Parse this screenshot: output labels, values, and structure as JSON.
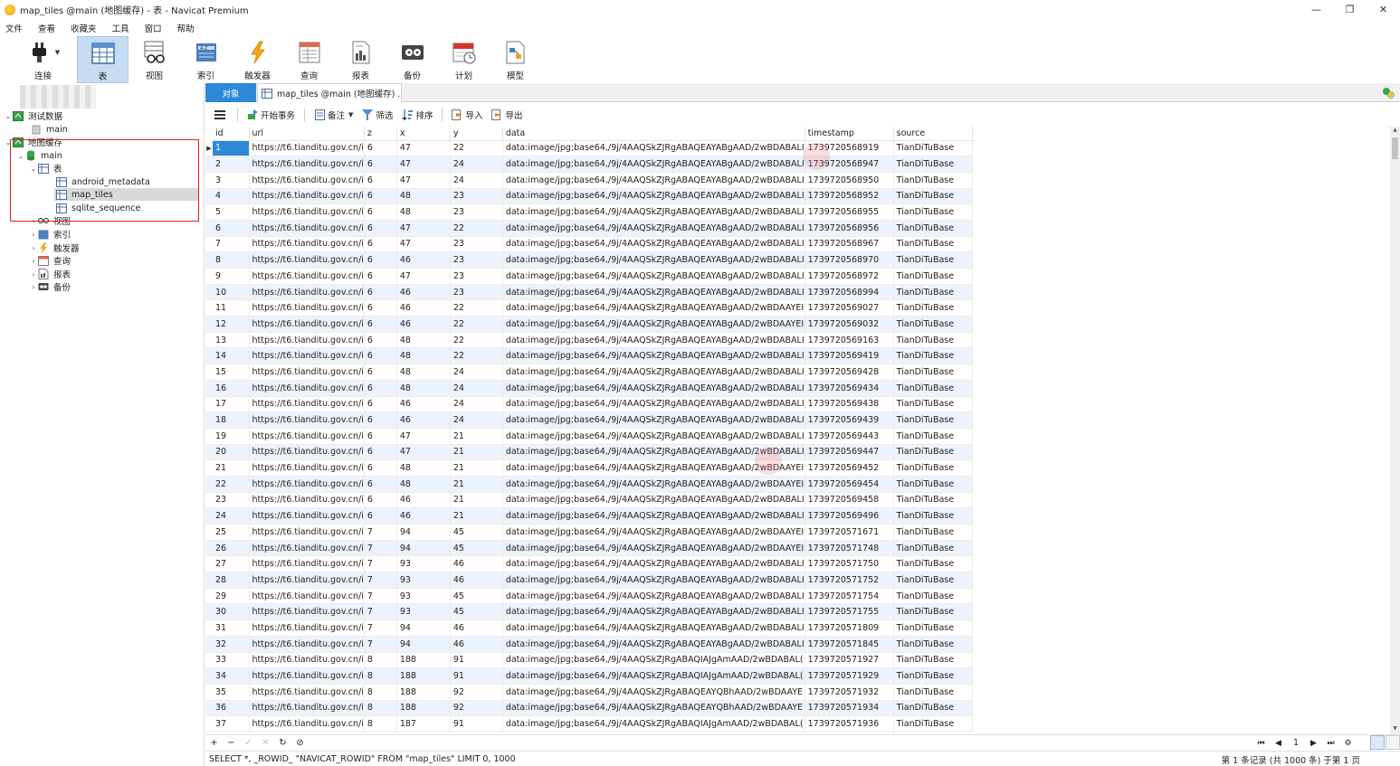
{
  "window": {
    "title": "map_tiles @main (地图缓存) - 表 - Navicat Premium",
    "minimize": "—",
    "restore": "❐",
    "close": "✕"
  },
  "menu": [
    "文件",
    "查看",
    "收藏夹",
    "工具",
    "窗口",
    "帮助"
  ],
  "toolbar": {
    "connect": "连接",
    "table": "表",
    "view": "视图",
    "index": "索引",
    "trigger": "触发器",
    "query": "查询",
    "report": "报表",
    "backup": "备份",
    "schedule": "计划",
    "model": "模型"
  },
  "tree": {
    "conn1": "测试数据",
    "conn1_db": "main",
    "conn2": "地图缓存",
    "conn2_db": "main",
    "tables_group": "表",
    "tables": [
      "android_metadata",
      "map_tiles",
      "sqlite_sequence"
    ],
    "groups": [
      "视图",
      "索引",
      "触发器",
      "查询",
      "报表",
      "备份"
    ]
  },
  "tabs": {
    "objects": "对象",
    "table_tab": "map_tiles @main (地图缓存) ..."
  },
  "grid_toolbar": {
    "begin_tx": "开始事务",
    "comment": "备注",
    "filter": "筛选",
    "sort": "排序",
    "import": "导入",
    "export": "导出"
  },
  "columns": [
    "id",
    "url",
    "z",
    "x",
    "y",
    "data",
    "timestamp",
    "source"
  ],
  "rows": [
    [
      "1",
      "https://t6.tianditu.gov.cn/i",
      "6",
      "47",
      "22",
      "data:image/jpg;base64,/9j/4AAQSkZJRgABAQEAYABgAAD/2wBDABALI",
      "1739720568919",
      "TianDiTuBase"
    ],
    [
      "2",
      "https://t6.tianditu.gov.cn/i",
      "6",
      "47",
      "24",
      "data:image/jpg;base64,/9j/4AAQSkZJRgABAQEAYABgAAD/2wBDABALI",
      "1739720568947",
      "TianDiTuBase"
    ],
    [
      "3",
      "https://t6.tianditu.gov.cn/i",
      "6",
      "47",
      "24",
      "data:image/jpg;base64,/9j/4AAQSkZJRgABAQEAYABgAAD/2wBDABALI",
      "1739720568950",
      "TianDiTuBase"
    ],
    [
      "4",
      "https://t6.tianditu.gov.cn/i",
      "6",
      "48",
      "23",
      "data:image/jpg;base64,/9j/4AAQSkZJRgABAQEAYABgAAD/2wBDABALI",
      "1739720568952",
      "TianDiTuBase"
    ],
    [
      "5",
      "https://t6.tianditu.gov.cn/i",
      "6",
      "48",
      "23",
      "data:image/jpg;base64,/9j/4AAQSkZJRgABAQEAYABgAAD/2wBDABALI",
      "1739720568955",
      "TianDiTuBase"
    ],
    [
      "6",
      "https://t6.tianditu.gov.cn/i",
      "6",
      "47",
      "22",
      "data:image/jpg;base64,/9j/4AAQSkZJRgABAQEAYABgAAD/2wBDABALI",
      "1739720568956",
      "TianDiTuBase"
    ],
    [
      "7",
      "https://t6.tianditu.gov.cn/i",
      "6",
      "47",
      "23",
      "data:image/jpg;base64,/9j/4AAQSkZJRgABAQEAYABgAAD/2wBDABALI",
      "1739720568967",
      "TianDiTuBase"
    ],
    [
      "8",
      "https://t6.tianditu.gov.cn/i",
      "6",
      "46",
      "23",
      "data:image/jpg;base64,/9j/4AAQSkZJRgABAQEAYABgAAD/2wBDABALI",
      "1739720568970",
      "TianDiTuBase"
    ],
    [
      "9",
      "https://t6.tianditu.gov.cn/i",
      "6",
      "47",
      "23",
      "data:image/jpg;base64,/9j/4AAQSkZJRgABAQEAYABgAAD/2wBDABALI",
      "1739720568972",
      "TianDiTuBase"
    ],
    [
      "10",
      "https://t6.tianditu.gov.cn/i",
      "6",
      "46",
      "23",
      "data:image/jpg;base64,/9j/4AAQSkZJRgABAQEAYABgAAD/2wBDABALI",
      "1739720568994",
      "TianDiTuBase"
    ],
    [
      "11",
      "https://t6.tianditu.gov.cn/i",
      "6",
      "46",
      "22",
      "data:image/jpg;base64,/9j/4AAQSkZJRgABAQEAYABgAAD/2wBDAAYEI",
      "1739720569027",
      "TianDiTuBase"
    ],
    [
      "12",
      "https://t6.tianditu.gov.cn/i",
      "6",
      "46",
      "22",
      "data:image/jpg;base64,/9j/4AAQSkZJRgABAQEAYABgAAD/2wBDAAYEI",
      "1739720569032",
      "TianDiTuBase"
    ],
    [
      "13",
      "https://t6.tianditu.gov.cn/i",
      "6",
      "48",
      "22",
      "data:image/jpg;base64,/9j/4AAQSkZJRgABAQEAYABgAAD/2wBDABALI",
      "1739720569163",
      "TianDiTuBase"
    ],
    [
      "14",
      "https://t6.tianditu.gov.cn/i",
      "6",
      "48",
      "22",
      "data:image/jpg;base64,/9j/4AAQSkZJRgABAQEAYABgAAD/2wBDABALI",
      "1739720569419",
      "TianDiTuBase"
    ],
    [
      "15",
      "https://t6.tianditu.gov.cn/i",
      "6",
      "48",
      "24",
      "data:image/jpg;base64,/9j/4AAQSkZJRgABAQEAYABgAAD/2wBDABALI",
      "1739720569428",
      "TianDiTuBase"
    ],
    [
      "16",
      "https://t6.tianditu.gov.cn/i",
      "6",
      "48",
      "24",
      "data:image/jpg;base64,/9j/4AAQSkZJRgABAQEAYABgAAD/2wBDABALI",
      "1739720569434",
      "TianDiTuBase"
    ],
    [
      "17",
      "https://t6.tianditu.gov.cn/i",
      "6",
      "46",
      "24",
      "data:image/jpg;base64,/9j/4AAQSkZJRgABAQEAYABgAAD/2wBDABALI",
      "1739720569438",
      "TianDiTuBase"
    ],
    [
      "18",
      "https://t6.tianditu.gov.cn/i",
      "6",
      "46",
      "24",
      "data:image/jpg;base64,/9j/4AAQSkZJRgABAQEAYABgAAD/2wBDABALI",
      "1739720569439",
      "TianDiTuBase"
    ],
    [
      "19",
      "https://t6.tianditu.gov.cn/i",
      "6",
      "47",
      "21",
      "data:image/jpg;base64,/9j/4AAQSkZJRgABAQEAYABgAAD/2wBDABALI",
      "1739720569443",
      "TianDiTuBase"
    ],
    [
      "20",
      "https://t6.tianditu.gov.cn/i",
      "6",
      "47",
      "21",
      "data:image/jpg;base64,/9j/4AAQSkZJRgABAQEAYABgAAD/2wBDABALI",
      "1739720569447",
      "TianDiTuBase"
    ],
    [
      "21",
      "https://t6.tianditu.gov.cn/i",
      "6",
      "48",
      "21",
      "data:image/jpg;base64,/9j/4AAQSkZJRgABAQEAYABgAAD/2wBDAAYEI",
      "1739720569452",
      "TianDiTuBase"
    ],
    [
      "22",
      "https://t6.tianditu.gov.cn/i",
      "6",
      "48",
      "21",
      "data:image/jpg;base64,/9j/4AAQSkZJRgABAQEAYABgAAD/2wBDAAYEI",
      "1739720569454",
      "TianDiTuBase"
    ],
    [
      "23",
      "https://t6.tianditu.gov.cn/i",
      "6",
      "46",
      "21",
      "data:image/jpg;base64,/9j/4AAQSkZJRgABAQEAYABgAAD/2wBDABALI",
      "1739720569458",
      "TianDiTuBase"
    ],
    [
      "24",
      "https://t6.tianditu.gov.cn/i",
      "6",
      "46",
      "21",
      "data:image/jpg;base64,/9j/4AAQSkZJRgABAQEAYABgAAD/2wBDABALI",
      "1739720569496",
      "TianDiTuBase"
    ],
    [
      "25",
      "https://t6.tianditu.gov.cn/i",
      "7",
      "94",
      "45",
      "data:image/jpg;base64,/9j/4AAQSkZJRgABAQEAYABgAAD/2wBDAAYEI",
      "1739720571671",
      "TianDiTuBase"
    ],
    [
      "26",
      "https://t6.tianditu.gov.cn/i",
      "7",
      "94",
      "45",
      "data:image/jpg;base64,/9j/4AAQSkZJRgABAQEAYABgAAD/2wBDAAYEI",
      "1739720571748",
      "TianDiTuBase"
    ],
    [
      "27",
      "https://t6.tianditu.gov.cn/i",
      "7",
      "93",
      "46",
      "data:image/jpg;base64,/9j/4AAQSkZJRgABAQEAYABgAAD/2wBDABALI",
      "1739720571750",
      "TianDiTuBase"
    ],
    [
      "28",
      "https://t6.tianditu.gov.cn/i",
      "7",
      "93",
      "46",
      "data:image/jpg;base64,/9j/4AAQSkZJRgABAQEAYABgAAD/2wBDABALI",
      "1739720571752",
      "TianDiTuBase"
    ],
    [
      "29",
      "https://t6.tianditu.gov.cn/i",
      "7",
      "93",
      "45",
      "data:image/jpg;base64,/9j/4AAQSkZJRgABAQEAYABgAAD/2wBDABALI",
      "1739720571754",
      "TianDiTuBase"
    ],
    [
      "30",
      "https://t6.tianditu.gov.cn/i",
      "7",
      "93",
      "45",
      "data:image/jpg;base64,/9j/4AAQSkZJRgABAQEAYABgAAD/2wBDABALI",
      "1739720571755",
      "TianDiTuBase"
    ],
    [
      "31",
      "https://t6.tianditu.gov.cn/i",
      "7",
      "94",
      "46",
      "data:image/jpg;base64,/9j/4AAQSkZJRgABAQEAYABgAAD/2wBDABALI",
      "1739720571809",
      "TianDiTuBase"
    ],
    [
      "32",
      "https://t6.tianditu.gov.cn/i",
      "7",
      "94",
      "46",
      "data:image/jpg;base64,/9j/4AAQSkZJRgABAQEAYABgAAD/2wBDABALI",
      "1739720571845",
      "TianDiTuBase"
    ],
    [
      "33",
      "https://t6.tianditu.gov.cn/i",
      "8",
      "188",
      "91",
      "data:image/jpg;base64,/9j/4AAQSkZJRgABAQIAJgAmAAD/2wBDABAL(",
      "1739720571927",
      "TianDiTuBase"
    ],
    [
      "34",
      "https://t6.tianditu.gov.cn/i",
      "8",
      "188",
      "91",
      "data:image/jpg;base64,/9j/4AAQSkZJRgABAQIAJgAmAAD/2wBDABAL(",
      "1739720571929",
      "TianDiTuBase"
    ],
    [
      "35",
      "https://t6.tianditu.gov.cn/i",
      "8",
      "188",
      "92",
      "data:image/jpg;base64,/9j/4AAQSkZJRgABAQEAYQBhAAD/2wBDAAYE",
      "1739720571932",
      "TianDiTuBase"
    ],
    [
      "36",
      "https://t6.tianditu.gov.cn/i",
      "8",
      "188",
      "92",
      "data:image/jpg;base64,/9j/4AAQSkZJRgABAQEAYQBhAAD/2wBDAAYE",
      "1739720571934",
      "TianDiTuBase"
    ],
    [
      "37",
      "https://t6.tianditu.gov.cn/i",
      "8",
      "187",
      "91",
      "data:image/jpg;base64,/9j/4AAQSkZJRgABAQIAJgAmAAD/2wBDABAL(",
      "1739720571936",
      "TianDiTuBase"
    ]
  ],
  "navigator": {
    "add": "+",
    "delete": "−",
    "apply": "✓",
    "cancel": "✕",
    "refresh": "↻",
    "stop": "⊘",
    "page": "1"
  },
  "status": {
    "sql": "SELECT *, _ROWID_ \"NAVICAT_ROWID\" FROM \"map_tiles\" LIMIT 0, 1000",
    "records": "第 1 条记录 (共 1000 条) 于第 1 页"
  },
  "colors": {
    "accent": "#2e88d8",
    "row_alt": "#ebf3fc",
    "highlight_box": "#e02020"
  }
}
